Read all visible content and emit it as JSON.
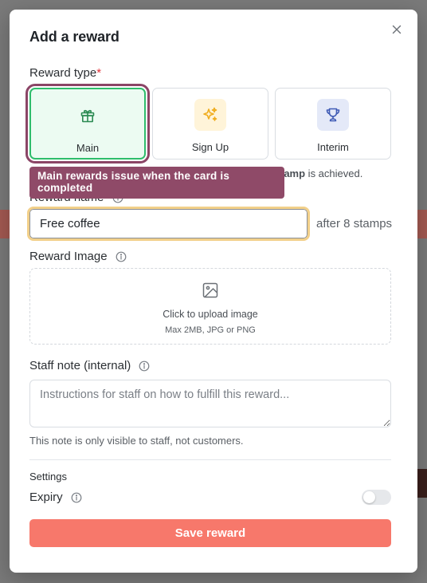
{
  "modal": {
    "title": "Add a reward"
  },
  "reward_type": {
    "label": "Reward type",
    "required_mark": "*",
    "options": [
      {
        "label": "Main",
        "icon": "gift-icon",
        "selected": true
      },
      {
        "label": "Sign Up",
        "icon": "sparkles-icon",
        "selected": false
      },
      {
        "label": "Interim",
        "icon": "trophy-icon",
        "selected": false
      }
    ],
    "helper_bold": "tamp",
    "helper_rest": " is achieved.",
    "tooltip": "Main rewards issue when the card is completed"
  },
  "reward_name": {
    "label": "Reward name",
    "value": "Free coffee",
    "suffix": "after 8 stamps"
  },
  "reward_image": {
    "label": "Reward Image",
    "upload_text": "Click to upload image",
    "upload_hint": "Max 2MB, JPG or PNG"
  },
  "staff_note": {
    "label": "Staff note (internal)",
    "placeholder": "Instructions for staff on how to fulfill this reward...",
    "help": "This note is only visible to staff, not customers."
  },
  "settings": {
    "label": "Settings",
    "expiry_label": "Expiry",
    "expiry_enabled": false
  },
  "actions": {
    "save_label": "Save reward"
  },
  "colors": {
    "selected_border": "#2fbd6c",
    "tooltip_bg": "#8f4a68",
    "save_bg": "#f7786b",
    "signup_icon": "#f5b92e",
    "interim_icon": "#3f5bb5"
  }
}
